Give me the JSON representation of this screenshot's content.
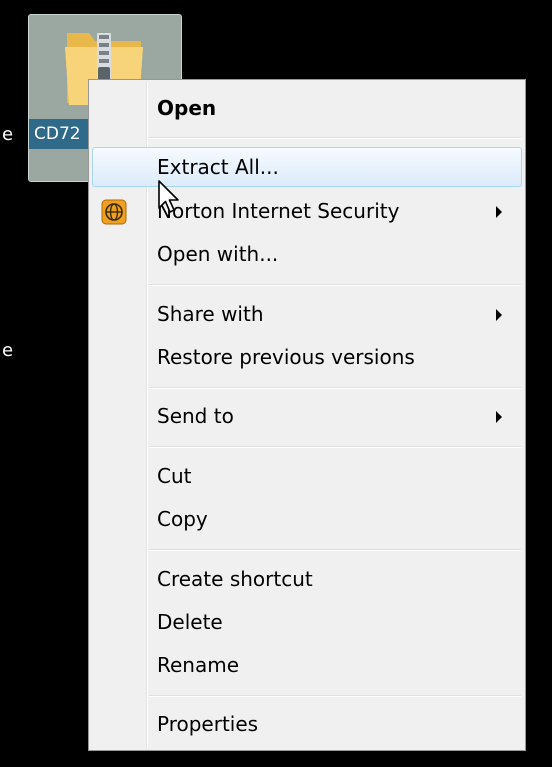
{
  "desktop": {
    "left_edge_labels": [
      "e",
      "e"
    ],
    "selected_file": {
      "caption": "CD72",
      "icon": "zip-folder-icon"
    }
  },
  "context_menu": {
    "items": {
      "open": {
        "label": "Open"
      },
      "extract_all": {
        "label": "Extract All..."
      },
      "norton": {
        "label": "Norton Internet Security",
        "icon": "norton-globe-icon"
      },
      "open_with": {
        "label": "Open with..."
      },
      "share_with": {
        "label": "Share with"
      },
      "restore": {
        "label": "Restore previous versions"
      },
      "send_to": {
        "label": "Send to"
      },
      "cut": {
        "label": "Cut"
      },
      "copy": {
        "label": "Copy"
      },
      "create_shortcut": {
        "label": "Create shortcut"
      },
      "delete": {
        "label": "Delete"
      },
      "rename": {
        "label": "Rename"
      },
      "properties": {
        "label": "Properties"
      }
    },
    "hovered_item": "extract_all"
  },
  "colors": {
    "menu_background": "#f0f0f0",
    "hover_border": "#a8d8eb",
    "selection_tile": "#9ba8a2",
    "caption_highlight": "#2f6a8a"
  }
}
